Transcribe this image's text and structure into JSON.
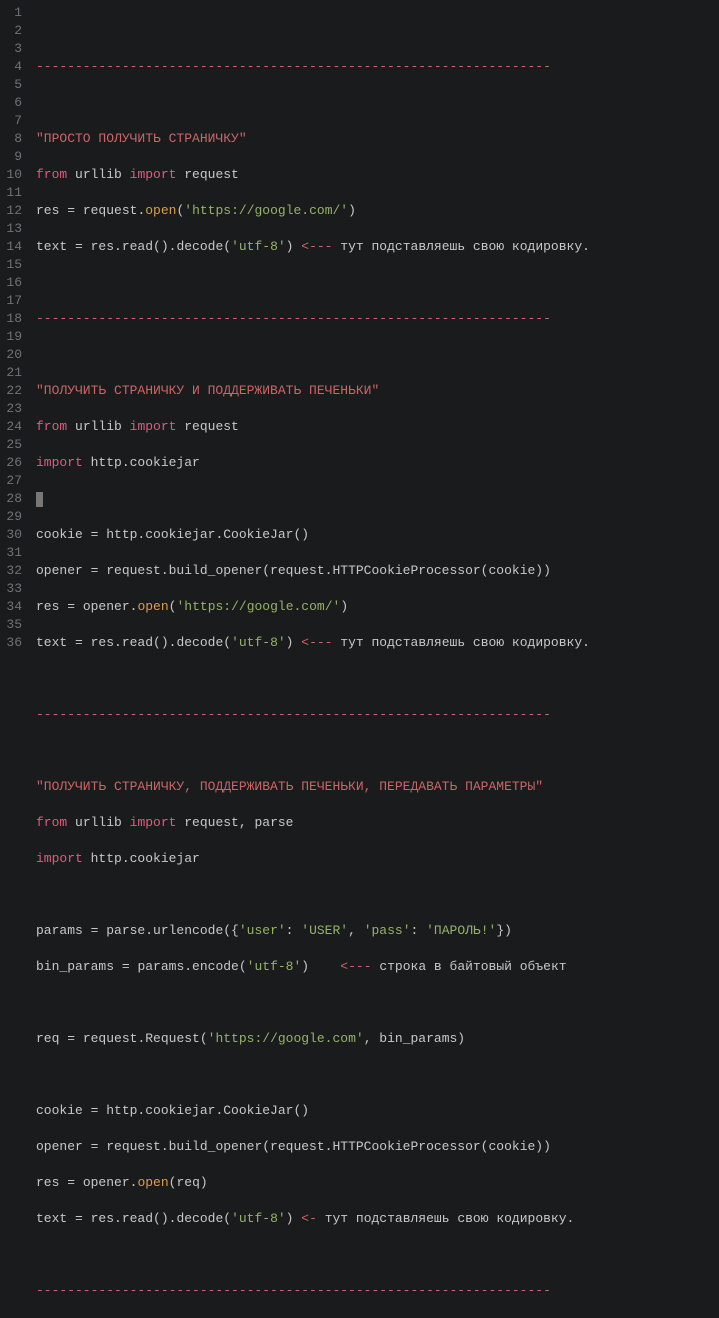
{
  "lines": {
    "1": "",
    "2sep": "------------------------------------------------------------------",
    "3": "",
    "4str": "\"ПРОСТО ПОЛУЧИТЬ СТРАНИЧКУ\"",
    "5a": "from",
    "5b": " urllib ",
    "5c": "import",
    "5d": " request",
    "6a": "res ",
    "6b": "=",
    "6c": " request.",
    "6d": "open",
    "6e": "(",
    "6f": "'https://google.com/'",
    "6g": ")",
    "7a": "text ",
    "7b": "=",
    "7c": " res.read().decode(",
    "7d": "'utf-8'",
    "7e": ") ",
    "7f": "<---",
    "7g": " тут подставляешь свою кодировку.",
    "8": "",
    "9sep": "------------------------------------------------------------------",
    "10": "",
    "11str": "\"ПОЛУЧИТЬ СТРАНИЧКУ И ПОДДЕРЖИВАТЬ ПЕЧЕНЬКИ\"",
    "12a": "from",
    "12b": " urllib ",
    "12c": "import",
    "12d": " request",
    "13a": "import",
    "13b": " http.cookiejar",
    "14": "",
    "15a": "cookie ",
    "15b": "=",
    "15c": " http.cookiejar.CookieJar()",
    "16a": "opener ",
    "16b": "=",
    "16c": " request.build_opener(request.HTTPCookieProcessor(cookie))",
    "17a": "res ",
    "17b": "=",
    "17c": " opener.",
    "17d": "open",
    "17e": "(",
    "17f": "'https://google.com/'",
    "17g": ")",
    "18a": "text ",
    "18b": "=",
    "18c": " res.read().decode(",
    "18d": "'utf-8'",
    "18e": ") ",
    "18f": "<---",
    "18g": " тут подставляешь свою кодировку.",
    "19": "",
    "20sep": "------------------------------------------------------------------",
    "21": "",
    "22str": "\"ПОЛУЧИТЬ СТРАНИЧКУ, ПОДДЕРЖИВАТЬ ПЕЧЕНЬКИ, ПЕРЕДАВАТЬ ПАРАМЕТРЫ\"",
    "23a": "from",
    "23b": " urllib ",
    "23c": "import",
    "23d": " request, parse",
    "24a": "import",
    "24b": " http.cookiejar",
    "25": "",
    "26a": "params ",
    "26b": "=",
    "26c": " parse.urlencode({",
    "26d": "'user'",
    "26e": ": ",
    "26f": "'USER'",
    "26g": ", ",
    "26h": "'pass'",
    "26i": ": ",
    "26j": "'ПАРОЛЬ!'",
    "26k": "})",
    "27a": "bin_params ",
    "27b": "=",
    "27c": " params.encode(",
    "27d": "'utf-8'",
    "27e": ")    ",
    "27f": "<---",
    "27g": " строка в байтовый объект",
    "28": "",
    "29a": "req ",
    "29b": "=",
    "29c": " request.Request(",
    "29d": "'https://google.com'",
    "29e": ", bin_params)",
    "30": "",
    "31a": "cookie ",
    "31b": "=",
    "31c": " http.cookiejar.CookieJar()",
    "32a": "opener ",
    "32b": "=",
    "32c": " request.build_opener(request.HTTPCookieProcessor(cookie))",
    "33a": "res ",
    "33b": "=",
    "33c": " opener.",
    "33d": "open",
    "33e": "(req)",
    "34a": "text ",
    "34b": "=",
    "34c": " res.read().decode(",
    "34d": "'utf-8'",
    "34e": ") ",
    "34f": "<-",
    "34g": " тут подставляешь свою кодировку.",
    "35": "",
    "36sep": "------------------------------------------------------------------"
  },
  "gutter": [
    "1",
    "2",
    "3",
    "4",
    "5",
    "6",
    "7",
    "8",
    "9",
    "10",
    "11",
    "12",
    "13",
    "14",
    "15",
    "16",
    "17",
    "18",
    "19",
    "20",
    "21",
    "22",
    "23",
    "24",
    "25",
    "26",
    "27",
    "28",
    "29",
    "30",
    "31",
    "32",
    "33",
    "34",
    "35",
    "36"
  ]
}
